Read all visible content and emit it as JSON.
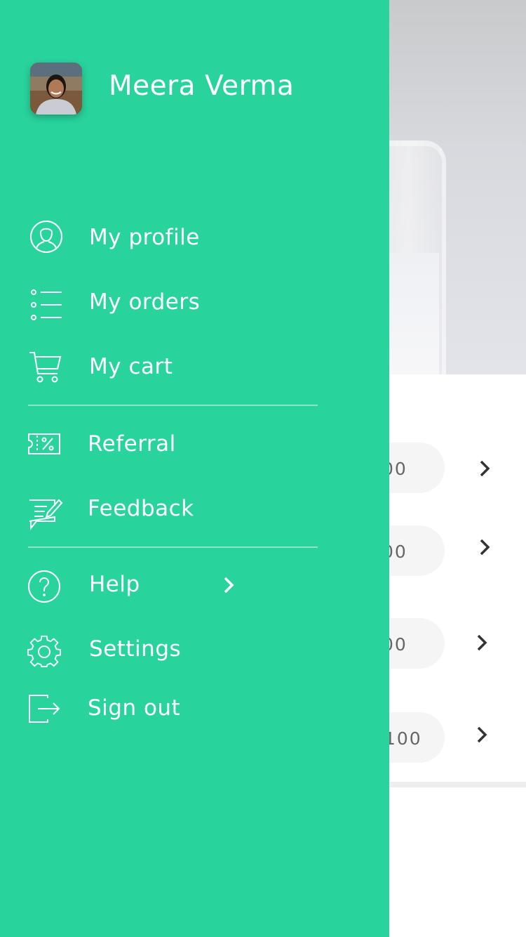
{
  "background": {
    "rows": [
      {
        "text": "00"
      },
      {
        "text": "00"
      },
      {
        "text": "00"
      },
      {
        "text": "100"
      }
    ]
  },
  "drawer": {
    "accent_color": "#28d39c",
    "user": {
      "name": "Meera Verma"
    },
    "menu": [
      {
        "label": "My profile",
        "icon": "user-icon"
      },
      {
        "label": "My orders",
        "icon": "list-icon"
      },
      {
        "label": "My cart",
        "icon": "cart-icon"
      },
      {
        "label": "Referral",
        "icon": "coupon-icon"
      },
      {
        "label": "Feedback",
        "icon": "feedback-icon"
      },
      {
        "label": "Help",
        "icon": "help-icon"
      },
      {
        "label": "Settings",
        "icon": "gear-icon"
      },
      {
        "label": "Sign out",
        "icon": "sign-out-icon"
      }
    ]
  }
}
